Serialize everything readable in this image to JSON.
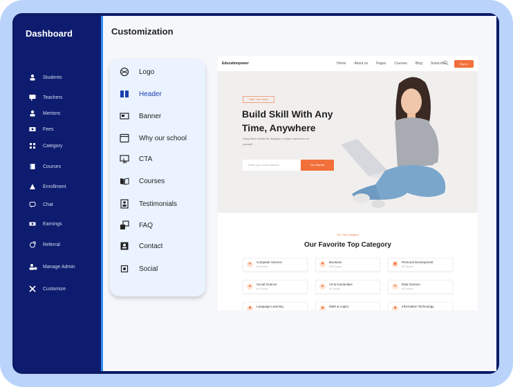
{
  "sidebar": {
    "title": "Dashboard",
    "items": [
      {
        "label": "Students",
        "icon": "user-icon"
      },
      {
        "label": "Teachers",
        "icon": "teacher-icon"
      },
      {
        "label": "Mentors",
        "icon": "mentor-icon"
      },
      {
        "label": "Fees",
        "icon": "fees-icon"
      },
      {
        "label": "Category",
        "icon": "category-icon"
      },
      {
        "label": "Courses",
        "icon": "book-icon"
      },
      {
        "label": "Enrollment",
        "icon": "enrollment-icon"
      },
      {
        "label": "Chat",
        "icon": "chat-icon"
      },
      {
        "label": "Earnings",
        "icon": "earnings-icon"
      },
      {
        "label": "Referral",
        "icon": "referral-icon"
      },
      {
        "label": "Manage Admin",
        "icon": "admin-icon"
      },
      {
        "label": "Customize",
        "icon": "tools-icon"
      }
    ]
  },
  "main": {
    "title": "Customization",
    "menu": [
      {
        "label": "Logo",
        "icon": "logo-icon"
      },
      {
        "label": "Header",
        "icon": "header-icon",
        "active": true
      },
      {
        "label": "Banner",
        "icon": "banner-icon"
      },
      {
        "label": "Why our school",
        "icon": "window-icon"
      },
      {
        "label": "CTA",
        "icon": "cta-icon"
      },
      {
        "label": "Courses",
        "icon": "courses-icon"
      },
      {
        "label": "Testimonials",
        "icon": "testimonials-icon"
      },
      {
        "label": "FAQ",
        "icon": "faq-icon"
      },
      {
        "label": "Contact",
        "icon": "contact-icon"
      },
      {
        "label": "Social",
        "icon": "social-icon"
      }
    ]
  },
  "preview": {
    "brand": "Educationpower",
    "nav_links": [
      "Home",
      "About us",
      "Pages",
      "Courses",
      "Blog",
      "Subscribe"
    ],
    "nav_button": "Sign in",
    "hero": {
      "tag": "Start Your Spirit",
      "heading_line1": "Build Skill With Any",
      "heading_line2": "Time, Anywhere",
      "sub": "Enjoy learn details for displays a unique impression on yourself",
      "input_placeholder": "Enter your email address",
      "button": "Get Started"
    },
    "category_sub": "Our Top Category",
    "category_title": "Our Favorite Top Category",
    "categories": [
      {
        "name": "Computer Science",
        "count": "60 Course"
      },
      {
        "name": "Business",
        "count": "100 Course"
      },
      {
        "name": "Personal Development",
        "count": "80 Course"
      },
      {
        "name": "Social Science",
        "count": "60 Course"
      },
      {
        "name": "Art & Humanities",
        "count": "60 Course"
      },
      {
        "name": "Data Science",
        "count": "60 Course"
      },
      {
        "name": "Language Learning",
        "count": ""
      },
      {
        "name": "Math & Logics",
        "count": ""
      },
      {
        "name": "Information Technology",
        "count": ""
      }
    ]
  },
  "colors": {
    "frame": "#b9d3fb",
    "sidebar": "#0d1c6e",
    "accent": "#2e8cf0",
    "orange": "#f2703a",
    "menu_bg": "#eaf3ff"
  }
}
